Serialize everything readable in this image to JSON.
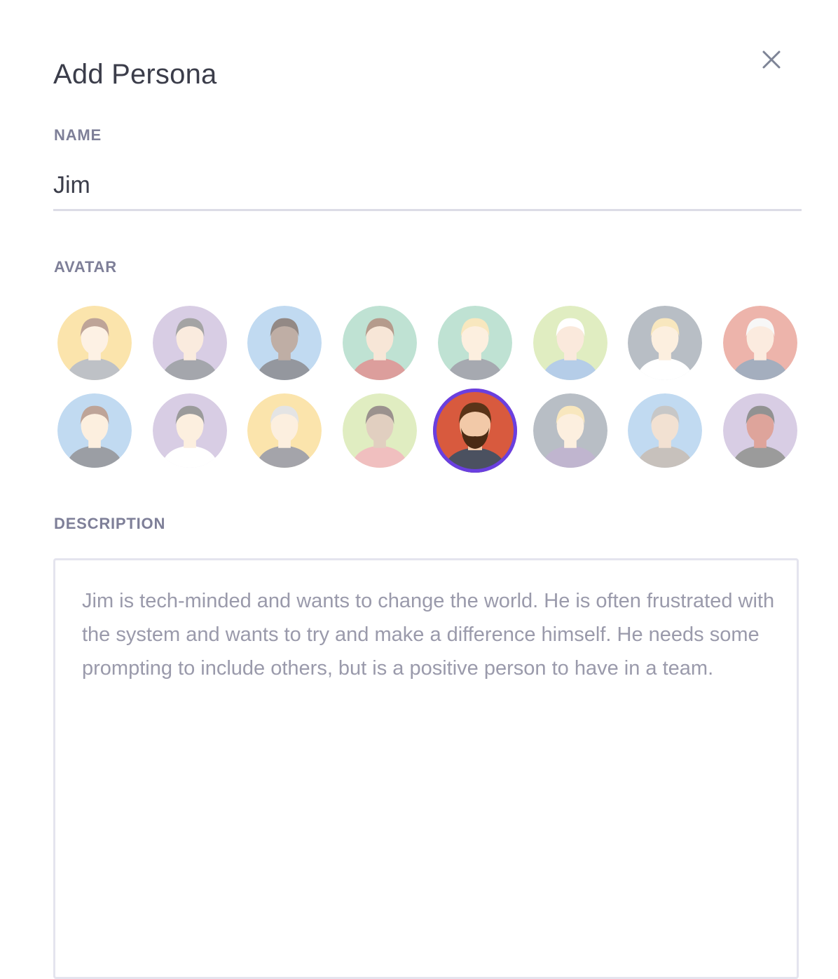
{
  "dialog": {
    "title": "Add Persona",
    "close_icon": "close-icon"
  },
  "name": {
    "label": "NAME",
    "value": "Jim"
  },
  "avatar": {
    "label": "AVATAR",
    "selected_index": 12,
    "items": [
      {
        "name": "avatar-hoodie-man",
        "bg": "#f8cf6a"
      },
      {
        "name": "avatar-sunglasses-man",
        "bg": "#b9a5cf"
      },
      {
        "name": "avatar-suit-man",
        "bg": "#8fbde6"
      },
      {
        "name": "avatar-bearded-plaid-man",
        "bg": "#8ccbb0"
      },
      {
        "name": "avatar-glasses-blond-man",
        "bg": "#8ccbb0"
      },
      {
        "name": "avatar-ny-cap-woman",
        "bg": "#c8df8f"
      },
      {
        "name": "avatar-business-man",
        "bg": "#7f8a96"
      },
      {
        "name": "avatar-old-man-mustache",
        "bg": "#e07868"
      },
      {
        "name": "avatar-glasses-woman",
        "bg": "#8fbde6"
      },
      {
        "name": "avatar-hat-mustache-man",
        "bg": "#b9a5cf"
      },
      {
        "name": "avatar-grandma",
        "bg": "#f8cf6a"
      },
      {
        "name": "avatar-long-hair-woman",
        "bg": "#c8df8f"
      },
      {
        "name": "avatar-bearded-man",
        "bg": "#d85a3e"
      },
      {
        "name": "avatar-headband-woman",
        "bg": "#7f8a96"
      },
      {
        "name": "avatar-hooded-old-man",
        "bg": "#8fbde6"
      },
      {
        "name": "avatar-horned-villain",
        "bg": "#b9a5cf"
      }
    ],
    "selected_ring": "#6a3fe0"
  },
  "description": {
    "label": "DESCRIPTION",
    "value": "Jim is tech-minded and wants to change the world. He is often frustrated with the system and wants to try and make a difference himself. He needs some prompting to include others, but is a positive person to have in a team."
  }
}
